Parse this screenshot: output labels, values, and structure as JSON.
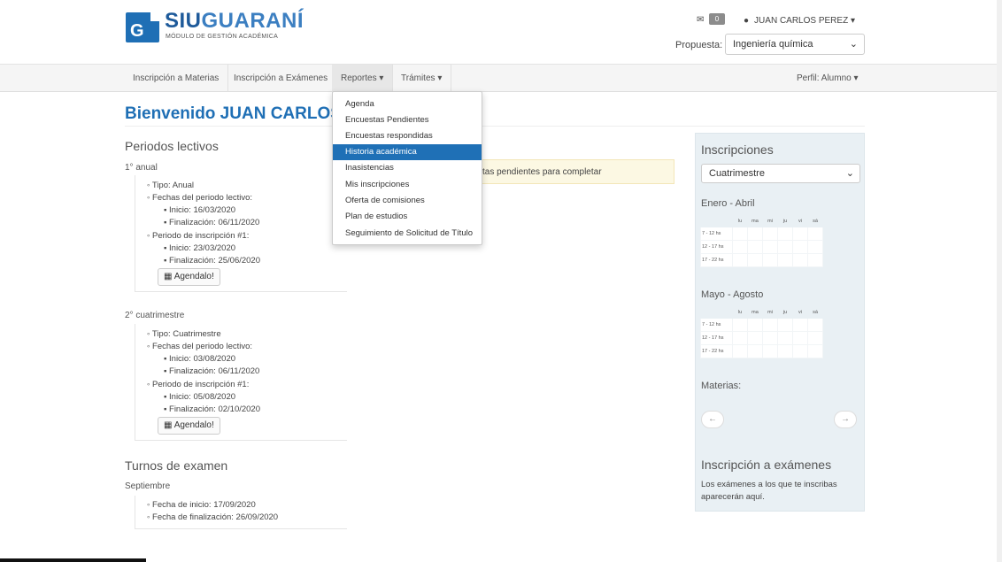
{
  "header": {
    "logo_letter": "G",
    "logo_title_a": "SIU",
    "logo_title_b": "GUARANÍ",
    "logo_subtitle": "MÓDULO DE GESTIÓN ACADÉMICA",
    "mail_count": "0",
    "user_name": "JUAN CARLOS PEREZ",
    "propuesta_label": "Propuesta:",
    "propuesta_value": "Ingeniería química"
  },
  "nav": {
    "items": [
      "Inscripción a Materias",
      "Inscripción a Exámenes",
      "Reportes",
      "Trámites"
    ],
    "perfil": "Perfil: Alumno"
  },
  "dropdown": {
    "items": [
      "Agenda",
      "Encuestas Pendientes",
      "Encuestas respondidas",
      "Historia académica",
      "Inasistencias",
      "Mis inscripciones",
      "Oferta de comisiones",
      "Plan de estudios",
      "Seguimiento de Solicitud de Título"
    ],
    "highlighted": "Historia académica"
  },
  "main": {
    "welcome": "Bienvenido JUAN CARLOŚ",
    "periodos_title": "Periodos lectivos",
    "periodo1": {
      "name": "1° anual",
      "tipo": "Tipo: Anual",
      "fechas": "Fechas del periodo lectivo:",
      "inicio": "Inicio: 16/03/2020",
      "fin": "Finalización: 06/11/2020",
      "insc": "Periodo de inscripción #1:",
      "insc_inicio": "Inicio: 23/03/2020",
      "insc_fin": "Finalización: 25/06/2020",
      "button": "Agendalo!"
    },
    "periodo2": {
      "name": "2° cuatrimestre",
      "tipo": "Tipo: Cuatrimestre",
      "fechas": "Fechas del periodo lectivo:",
      "inicio": "Inicio: 03/08/2020",
      "fin": "Finalización: 06/11/2020",
      "insc": "Periodo de inscripción #1:",
      "insc_inicio": "Inicio: 05/08/2020",
      "insc_fin": "Finalización: 02/10/2020",
      "button": "Agendalo!"
    },
    "turnos_title": "Turnos de examen",
    "turno": {
      "name": "Septiembre",
      "inicio": "Fecha de inicio: 17/09/2020",
      "fin": "Fecha de finalización: 26/09/2020"
    },
    "alert": "tas pendientes para completar"
  },
  "sidebar": {
    "title": "Inscripciones",
    "select_value": "Cuatrimestre",
    "block1_title": "Enero - Abril",
    "block2_title": "Mayo - Agosto",
    "days": [
      "lu",
      "ma",
      "mi",
      "ju",
      "vi",
      "sá"
    ],
    "rows": [
      "7 - 12 hs",
      "12 - 17 hs",
      "17 - 22 hs"
    ],
    "materias_label": "Materias:",
    "prev": "←",
    "next": "→",
    "examenes_title": "Inscripción a exámenes",
    "examenes_text": "Los exámenes a los que te inscribas aparecerán aquí."
  }
}
